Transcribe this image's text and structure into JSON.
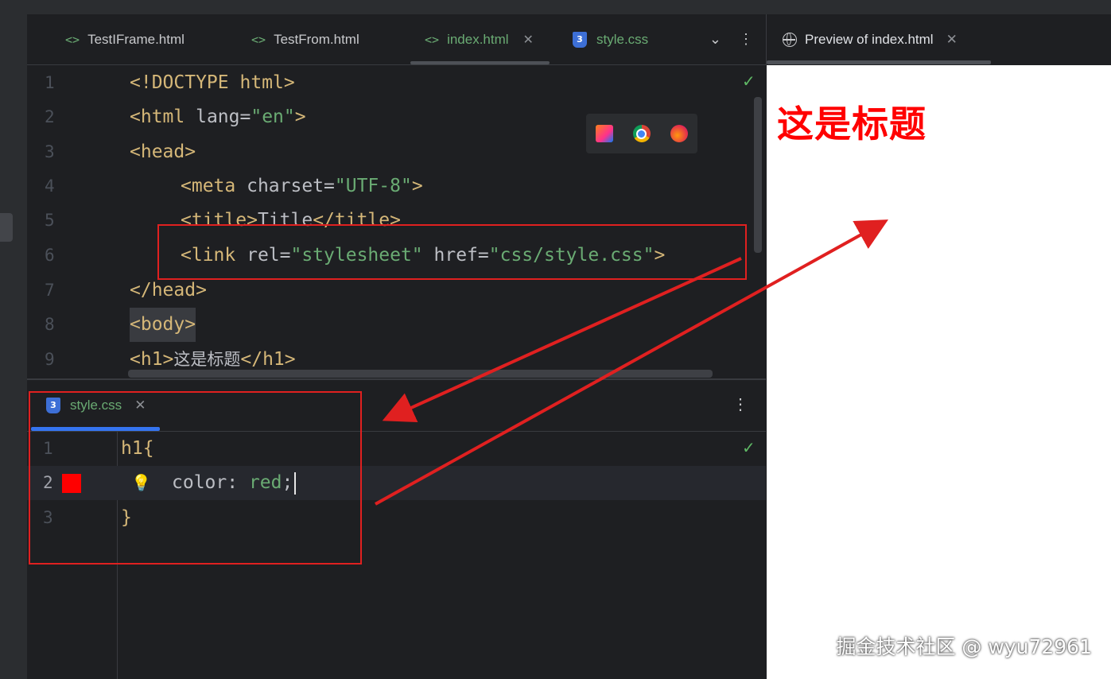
{
  "editor_tabs": [
    {
      "label": "TestIFrame.html",
      "icon": "html-icon"
    },
    {
      "label": "TestFrom.html",
      "icon": "html-icon"
    },
    {
      "label": "index.html",
      "icon": "html-icon",
      "active": true
    },
    {
      "label": "style.css",
      "icon": "css-icon"
    }
  ],
  "code_lines": [
    {
      "n": "1"
    },
    {
      "n": "2"
    },
    {
      "n": "3"
    },
    {
      "n": "4"
    },
    {
      "n": "5"
    },
    {
      "n": "6"
    },
    {
      "n": "7"
    },
    {
      "n": "8"
    },
    {
      "n": "9"
    }
  ],
  "code_text": {
    "l1": "<!DOCTYPE html>",
    "l2_open": "<html ",
    "l2_attr": "lang=",
    "l2_val": "\"en\"",
    "l2_close": ">",
    "l3": "<head>",
    "l4_open": "<meta ",
    "l4_attr": "charset=",
    "l4_val": "\"UTF-8\"",
    "l4_close": ">",
    "l5_open": "<title>",
    "l5_text": "Title",
    "l5_close": "</title>",
    "l6_open": "<link ",
    "l6_attr1": "rel=",
    "l6_val1": "\"stylesheet\"",
    "l6_attr2": " href=",
    "l6_val2": "\"css/style.css\"",
    "l6_close": ">",
    "l7": "</head>",
    "l8": "<body>",
    "l9_open": "<h1>",
    "l9_text": "这是标题",
    "l9_close": "</h1>"
  },
  "bottom_tab": {
    "label": "style.css",
    "icon": "css-icon"
  },
  "css_lines": {
    "n1": "1",
    "n2": "2",
    "n3": "3",
    "l1": "h1{",
    "l2_prop": "color: ",
    "l2_val": "red",
    "l2_end": ";",
    "l3": "}"
  },
  "swatch_color": "#ff0000",
  "preview": {
    "tab_label": "Preview of index.html",
    "heading": "这是标题",
    "heading_color": "#ff0000"
  },
  "watermark": "掘金技术社区 @ wyu72961",
  "colors": {
    "accent": "#3574f0",
    "annotation": "#e02020",
    "string": "#6aab73",
    "tag": "#d5b778"
  }
}
